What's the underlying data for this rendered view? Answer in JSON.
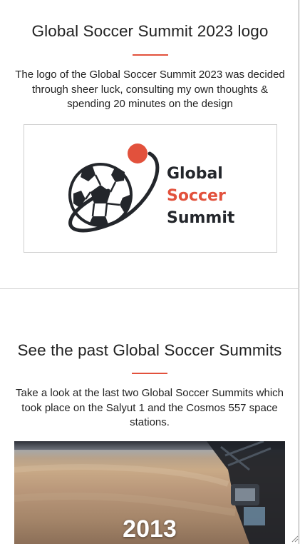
{
  "logo_section": {
    "title": "Global Soccer Summit 2023 logo",
    "description": "The logo of the Global Soccer Summit 2023 was decided through sheer luck, consulting my own thoughts & spending 20 minutes on the design",
    "logo_text": [
      "Global",
      "Soccer",
      "Summit"
    ]
  },
  "past_section": {
    "title": "See the past Global Soccer Summits",
    "description": "Take a look at the last two Global Soccer Summits which took place on the Salyut 1 and the Cosmos 557 space stations.",
    "photo_caption": "2013"
  },
  "colors": {
    "accent": "#e2513c",
    "text": "#222222",
    "logo_dark": "#23262b"
  }
}
